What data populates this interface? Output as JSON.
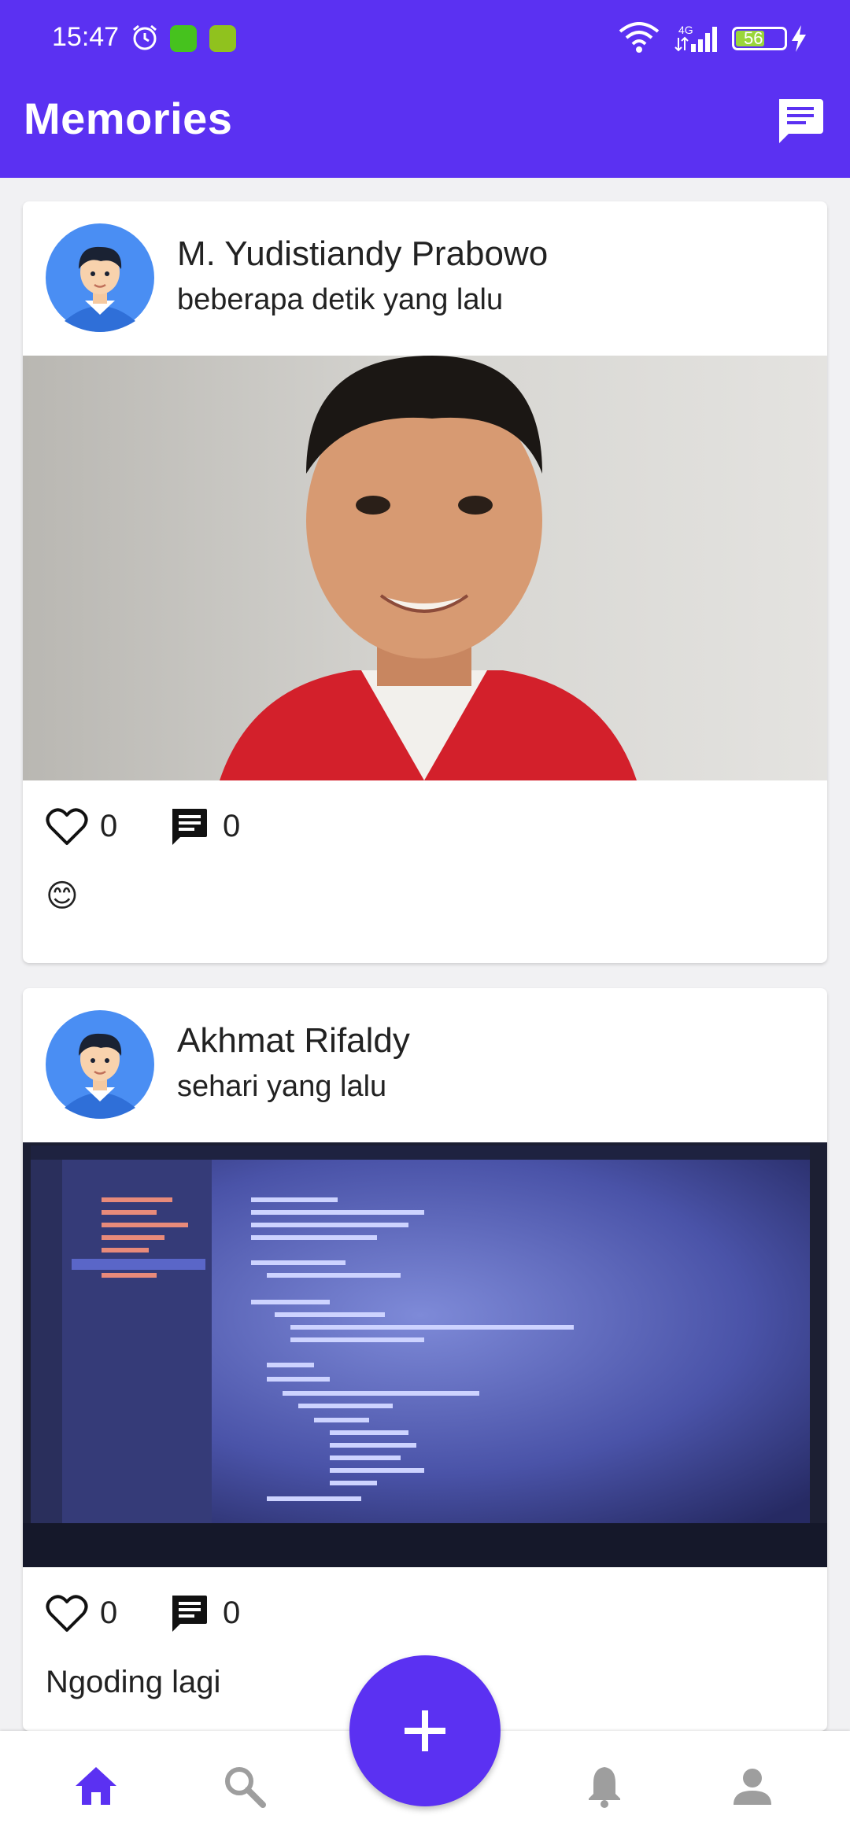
{
  "status_bar": {
    "time": "15:47",
    "network": "4G",
    "battery": "56"
  },
  "app_bar": {
    "title": "Memories"
  },
  "posts": [
    {
      "author": "M. Yudistiandy Prabowo",
      "time": "beberapa detik yang lalu",
      "likes": "0",
      "comments": "0",
      "caption": "😊"
    },
    {
      "author": "Akhmat Rifaldy",
      "time": "sehari yang lalu",
      "likes": "0",
      "comments": "0",
      "caption": "Ngoding lagi"
    }
  ],
  "colors": {
    "primary": "#5b31f2",
    "background": "#f1f1f3",
    "avatar_bg": "#4a8ef3"
  },
  "bottom_nav": {
    "items": [
      "home-icon",
      "search-icon",
      "add-icon",
      "bell-icon",
      "person-icon"
    ],
    "active": "home-icon"
  }
}
